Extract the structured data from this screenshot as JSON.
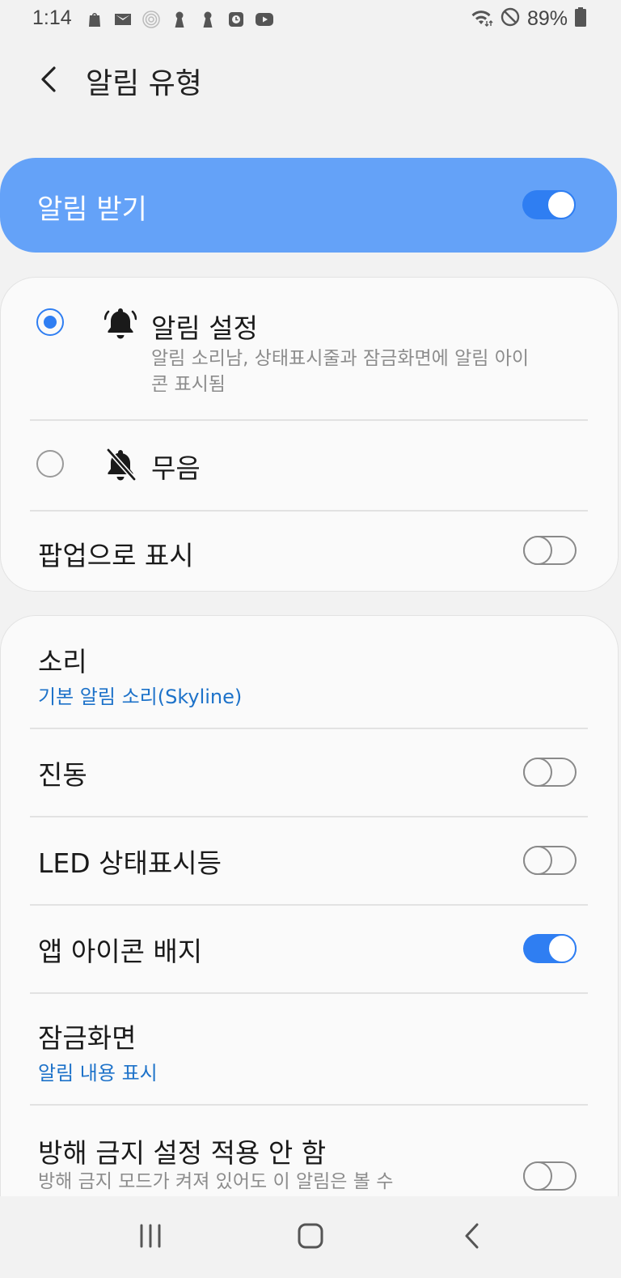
{
  "status_bar": {
    "time": "1:14",
    "left_icons": [
      "shopping-bag-icon",
      "mail-icon",
      "hotspot-icon",
      "keyhole-icon",
      "keyhole-icon",
      "clock-app-icon",
      "youtube-icon"
    ],
    "right_icons": [
      "wifi-icon",
      "do-not-disturb-icon",
      "battery-icon"
    ],
    "battery": "89%"
  },
  "header": {
    "title": "알림 유형"
  },
  "master_switch": {
    "label": "알림 받기",
    "on": true
  },
  "alert_card": {
    "alert_option": {
      "title": "알림 설정",
      "description": "알림 소리남, 상태표시줄과 잠금화면에 알림 아이콘 표시됨",
      "selected": true
    },
    "silent_option": {
      "title": "무음",
      "selected": false
    },
    "popup": {
      "title": "팝업으로 표시",
      "on": false
    }
  },
  "settings_card": {
    "sound": {
      "title": "소리",
      "value": "기본 알림 소리(Skyline)"
    },
    "vibration": {
      "title": "진동",
      "on": false
    },
    "led": {
      "title": "LED 상태표시등",
      "on": false
    },
    "badge": {
      "title": "앱 아이콘 배지",
      "on": true
    },
    "lock_screen": {
      "title": "잠금화면",
      "value": "알림 내용 표시"
    },
    "dnd_override": {
      "title": "방해 금지 설정 적용 안 함",
      "description": "방해 금지 모드가 켜져 있어도 이 알림은 볼 수",
      "on": false
    }
  },
  "navigation_bar": [
    "recent-apps-icon",
    "home-icon",
    "back-icon"
  ],
  "colors": {
    "accent": "#2f7ef2",
    "master_bg": "#64a2f8",
    "link": "#1d72c9"
  }
}
